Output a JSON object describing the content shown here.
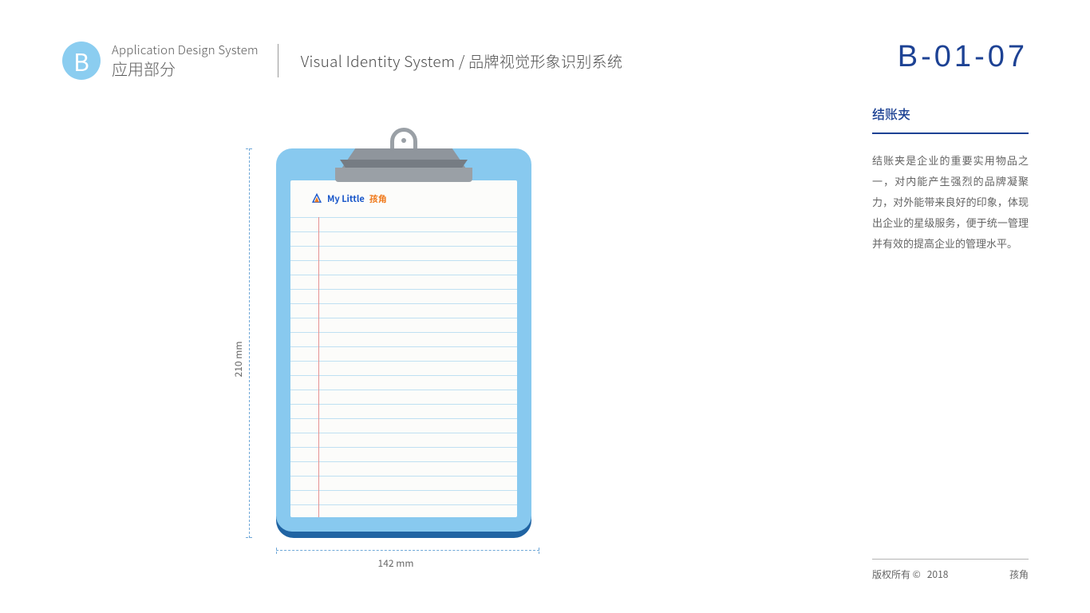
{
  "header": {
    "badge_letter": "B",
    "subtitle_en": "Application Design System",
    "subtitle_cn": "应用部分",
    "system_title": "Visual Identity System / 品牌视觉形象识别系统"
  },
  "page_code": "B-01-07",
  "right": {
    "title": "结账夹",
    "body": "结账夹是企业的重要实用物品之一，对内能产生强烈的品牌凝聚力，对外能带来良好的印象，体现出企业的星级服务，便于统一管理并有效的提高企业的管理水平。"
  },
  "figure": {
    "height_label": "210 mm",
    "width_label": "142 mm",
    "brand_en": "My Little",
    "brand_cn": "孩角"
  },
  "footer": {
    "copyright": "版权所有 ©",
    "year": "2018",
    "brand": "孩角"
  }
}
